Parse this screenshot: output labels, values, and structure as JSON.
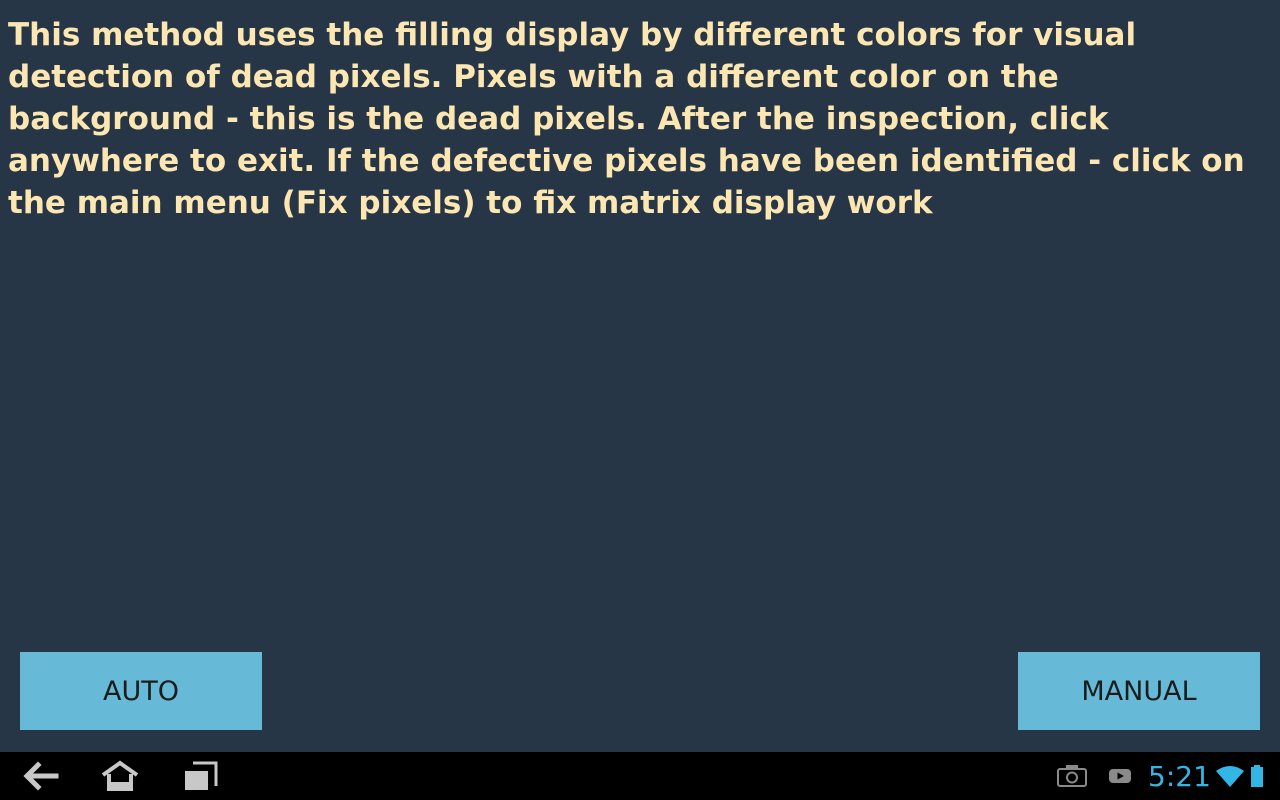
{
  "app": {
    "instructions": "This method uses the filling display by different colors for visual detection of dead pixels. Pixels with a different color on the background - this is the dead pixels. After the inspection, click anywhere to exit. If the defective pixels have been identified - click on the main menu (Fix pixels) to fix matrix display work",
    "auto_label": "AUTO",
    "manual_label": "MANUAL"
  },
  "system_bar": {
    "nav_icons": [
      "back-icon",
      "home-icon",
      "recent-apps-icon"
    ],
    "status_icons": [
      "camera-icon",
      "youtube-icon",
      "wifi-icon",
      "battery-icon"
    ],
    "clock": "5:21"
  },
  "colors": {
    "background": "#273646",
    "text": "#FCE6B2",
    "button": "#67BAD7",
    "accent": "#33B5E5",
    "navbar": "#000000"
  }
}
